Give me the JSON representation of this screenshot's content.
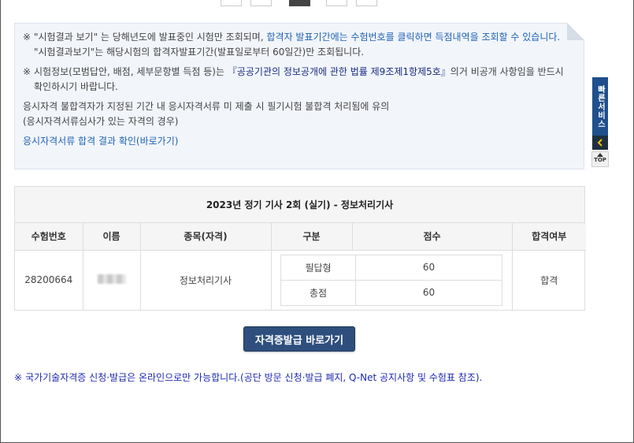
{
  "notice": {
    "line1_mark": "※",
    "line1_a": "\"시험결과 보기\" 는 당해년도에 발표중인 시험만 조회되며, ",
    "line1_b": "합격자 발표기간에는 수험번호를 클릭하면 득점내역을 조회할 수 있습니다.",
    "line1_c": " \"시험결과보기\"는 해당시험의 합격자발표기간(발표일로부터 60일간)만 조회됩니다.",
    "line2_mark": "※",
    "line2_a": "시험정보(모범답안, 배점, 세부문항별 득점 등)는 ",
    "line2_b": "『공공기관의 정보공개에 관한 법률 제9조제1항제5호』",
    "line2_c": "의거 비공개 사항임을 반드시 확인하시기 바랍니다.",
    "line3": "응시자격 불합격자가 지정된 기간 내 응시자격서류 미 제출 시 필기시험 불합격 처리됨에 유의",
    "line4": "(응시자격서류심사가 있는 자격의 경우)",
    "link": "응시자격서류 합격 결과 확인(바로가기)"
  },
  "result": {
    "title": "2023년 정기 기사 2회 (실기) - 정보처리기사",
    "headers": [
      "수험번호",
      "이름",
      "종목(자격)",
      "구분",
      "점수",
      "합격여부"
    ],
    "row": {
      "exam_no": "28200664",
      "subject": "정보처리기사",
      "status": "합격"
    },
    "scores": [
      {
        "label": "필답형",
        "score": "60"
      },
      {
        "label": "총점",
        "score": "60"
      }
    ]
  },
  "button_label": "자격증발급 바로가기",
  "footnote": {
    "mark": "※",
    "text": "국가기술자격증 신청·발급은 온라인으로만 가능합니다.(공단 방문 신청·발급 폐지, Q-Net 공지사항 및 수험표 참조)."
  },
  "quick": {
    "label": "빠른서비스",
    "top_label": "TOP"
  },
  "colors": {
    "button": "#2e4f7e",
    "link": "#1f63b5",
    "footnote": "#1d29b0",
    "quick_panel": "#1f4f8c"
  }
}
